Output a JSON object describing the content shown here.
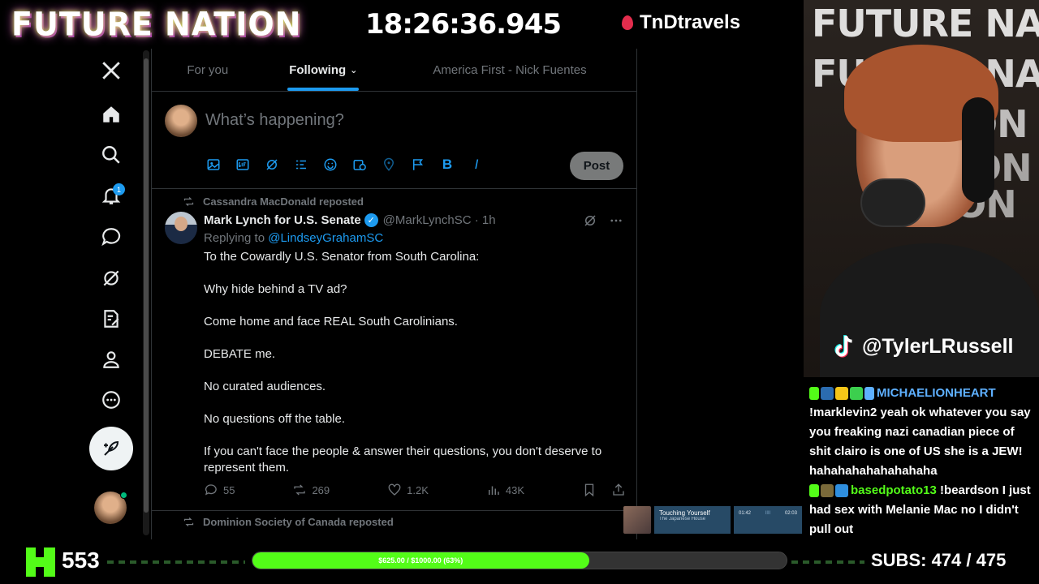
{
  "overlay": {
    "brand": "FUTURE NATION",
    "clock": "18:26:36.945",
    "sponsor": "TnDtravels",
    "tiktok_handle": "@TylerLRussell",
    "kick_viewers": "553",
    "goal_label": "$625.00 / $1000.00 (63%)",
    "goal_progress": 0.63,
    "subs_label": "SUBS:",
    "subs_value": "474 / 475",
    "cam_bg_text": [
      "FUTURE NATION",
      "FUTURE NATION",
      "ON",
      "ON",
      "ION"
    ]
  },
  "nav": {
    "notifications_badge": "1",
    "icons": [
      "x-logo-icon",
      "home-icon",
      "search-icon",
      "bell-icon",
      "message-icon",
      "grok-icon",
      "draft-icon",
      "profile-icon",
      "more-icon"
    ]
  },
  "tabs": [
    {
      "label": "For you"
    },
    {
      "label": "Following"
    },
    {
      "label": "America First - Nick Fuentes"
    }
  ],
  "composer": {
    "placeholder": "What’s happening?",
    "post_label": "Post",
    "bold": "B",
    "italic": "I"
  },
  "tweet": {
    "repost_by": "Cassandra MacDonald reposted",
    "name": "Mark Lynch for U.S. Senate",
    "handle": "@MarkLynchSC · 1h",
    "replying_prefix": "Replying to ",
    "replying_to": "@LindseyGrahamSC",
    "body": [
      "To the Cowardly U.S. Senator from South Carolina:",
      "Why hide behind a TV ad?",
      "Come home and face REAL South Carolinians.",
      "DEBATE me.",
      "No curated audiences.",
      "No questions off the table.",
      "If you can't face the people & answer their questions, you don't deserve to represent them."
    ],
    "replies": "55",
    "reposts": "269",
    "likes": "1.2K",
    "views": "43K"
  },
  "tweet2": {
    "repost_by": "Dominion Society of Canada reposted"
  },
  "chat": [
    {
      "user": "MICHAELIONHEART",
      "color": "#5eb0ff",
      "text": "!marklevin2 yeah ok whatever you say you freaking nazi canadian piece of shit clairo is one of US she is a JEW! hahahahahahahahaha"
    },
    {
      "user": "basedpotato13",
      "color": "#53fc18",
      "text": "!beardson I just had sex with Melanie Mac no I didn't pull out"
    }
  ],
  "now_playing": {
    "title": "Touching Yourself",
    "artist": "The Japanese House",
    "elapsed": "01:42",
    "total": "02:03"
  },
  "colors": {
    "accent": "#1d9bf0",
    "kick_green": "#53fc18",
    "border": "#2f3336"
  }
}
